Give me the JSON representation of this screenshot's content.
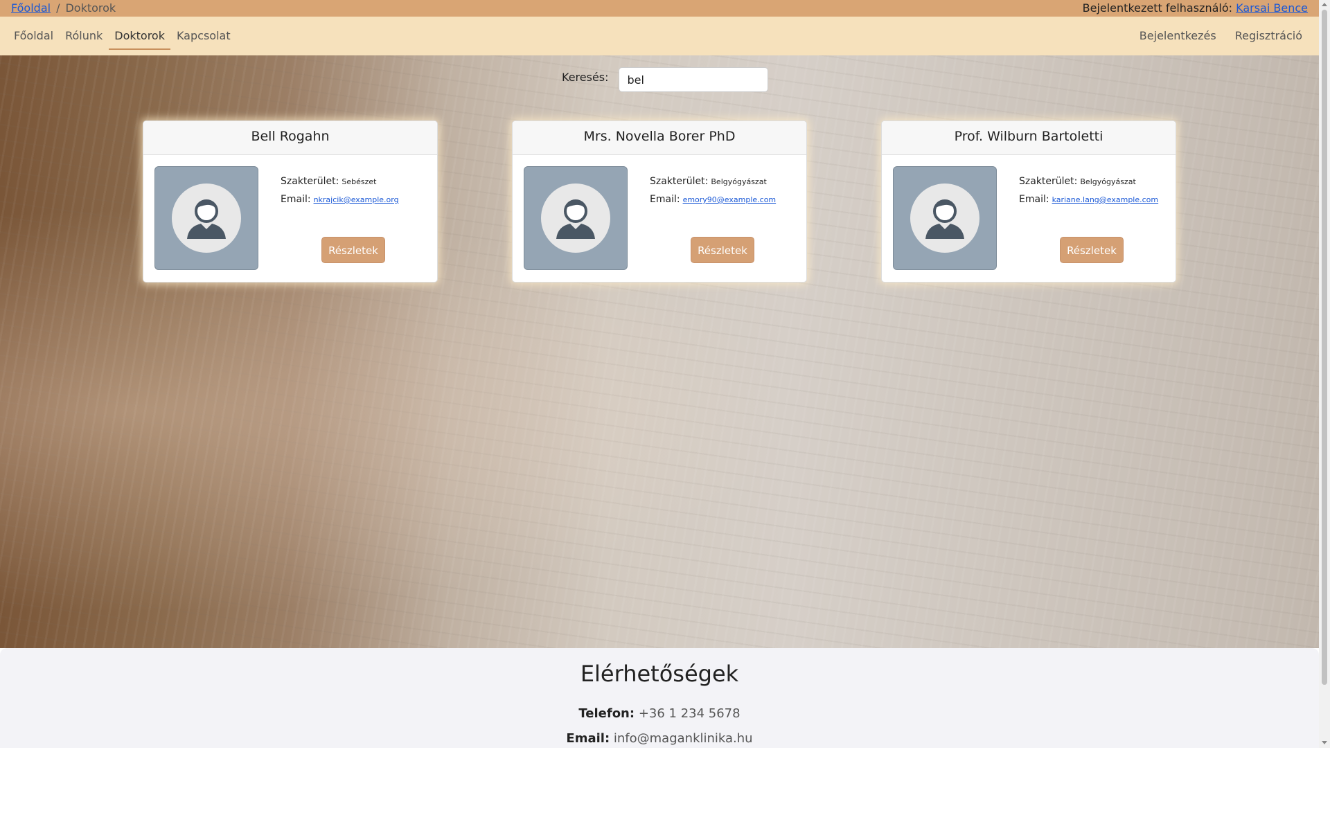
{
  "breadcrumb": {
    "home": "Főoldal",
    "separator": "/",
    "current": "Doktorok"
  },
  "user_bar": {
    "label": "Bejelentkezett felhasználó:",
    "name": "Karsai Bence"
  },
  "nav": {
    "left": [
      {
        "label": "Főoldal",
        "active": false
      },
      {
        "label": "Rólunk",
        "active": false
      },
      {
        "label": "Doktorok",
        "active": true
      },
      {
        "label": "Kapcsolat",
        "active": false
      }
    ],
    "right": [
      {
        "label": "Bejelentkezés"
      },
      {
        "label": "Regisztráció"
      }
    ]
  },
  "search": {
    "label": "Keresés:",
    "value": "bel"
  },
  "doctors": [
    {
      "name": "Bell Rogahn",
      "specialty_label": "Szakterület:",
      "specialty": "Sebészet",
      "email_label": "Email:",
      "email": "nkrajcik@example.org",
      "button": "Részletek",
      "avatar_icon": "person-icon"
    },
    {
      "name": "Mrs. Novella Borer PhD",
      "specialty_label": "Szakterület:",
      "specialty": "Belgyógyászat",
      "email_label": "Email:",
      "email": "emory90@example.com",
      "button": "Részletek",
      "avatar_icon": "person-icon"
    },
    {
      "name": "Prof. Wilburn Bartoletti",
      "specialty_label": "Szakterület:",
      "specialty": "Belgyógyászat",
      "email_label": "Email:",
      "email": "kariane.lang@example.com",
      "button": "Részletek",
      "avatar_icon": "person-icon"
    }
  ],
  "footer": {
    "title": "Elérhetőségek",
    "phone_label": "Telefon:",
    "phone": "+36 1 234 5678",
    "email_label": "Email:",
    "email": "info@maganklinika.hu"
  },
  "colors": {
    "topbar": "#d9a574",
    "navbar": "#f6e1bc",
    "button": "#d5a074",
    "link": "#1a58d6"
  }
}
